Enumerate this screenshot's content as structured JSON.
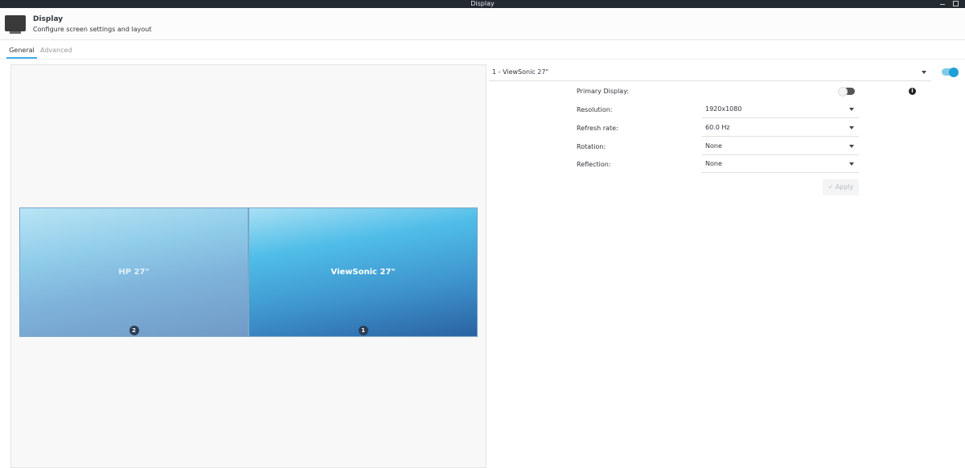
{
  "window": {
    "title": "Display"
  },
  "header": {
    "title": "Display",
    "subtitle": "Configure screen settings and layout"
  },
  "tabs": [
    {
      "label": "General",
      "active": true
    },
    {
      "label": "Advanced",
      "active": false
    }
  ],
  "monitors": [
    {
      "name": "HP 27\"",
      "number": "2"
    },
    {
      "name": "ViewSonic 27\"",
      "number": "1"
    }
  ],
  "output_select": {
    "value": "1 - ViewSonic 27\"",
    "enabled": true
  },
  "form": {
    "primary_label": "Primary Display:",
    "primary_on": false,
    "resolution_label": "Resolution:",
    "resolution": "1920x1080",
    "refresh_label": "Refresh rate:",
    "refresh": "60.0 Hz",
    "rotation_label": "Rotation:",
    "rotation": "None",
    "reflection_label": "Reflection:",
    "reflection": "None",
    "apply_label": "✓ Apply"
  },
  "colors": {
    "accent": "#3daee9",
    "titlebar": "#232a30"
  }
}
